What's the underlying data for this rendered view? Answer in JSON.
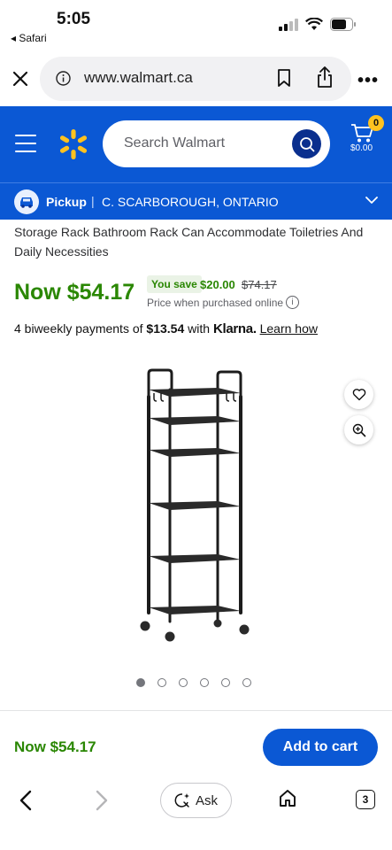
{
  "status_bar": {
    "time": "5:05",
    "back_app": "◂ Safari"
  },
  "browser": {
    "url": "www.walmart.ca"
  },
  "header": {
    "search_placeholder": "Search Walmart",
    "cart_count": "0",
    "cart_total": "$0.00"
  },
  "pickup": {
    "label": "Pickup",
    "separator": "|",
    "location": "C. SCARBOROUGH, ONTARIO"
  },
  "product": {
    "title": "Storage Rack Bathroom Rack Can Accommodate Toiletries And Daily Necessities",
    "price_now": "Now $54.17",
    "you_save_label": "You save",
    "save_amount": "$20.00",
    "was_price": "$74.17",
    "price_note": "Price when purchased online",
    "installments_prefix": "4 biweekly payments of",
    "installment_amount": "$13.54",
    "installments_with": "with",
    "klarna": "Klarna.",
    "learn_how": "Learn how",
    "image_count": 6,
    "active_image": 1
  },
  "sticky": {
    "price": "Now $54.17",
    "add_to_cart": "Add to cart"
  },
  "toolbar": {
    "ask_label": "Ask",
    "tab_count": "3"
  },
  "colors": {
    "walmart_blue": "#0b58d4",
    "walmart_yellow": "#ffc220",
    "price_green": "#2a8703"
  }
}
